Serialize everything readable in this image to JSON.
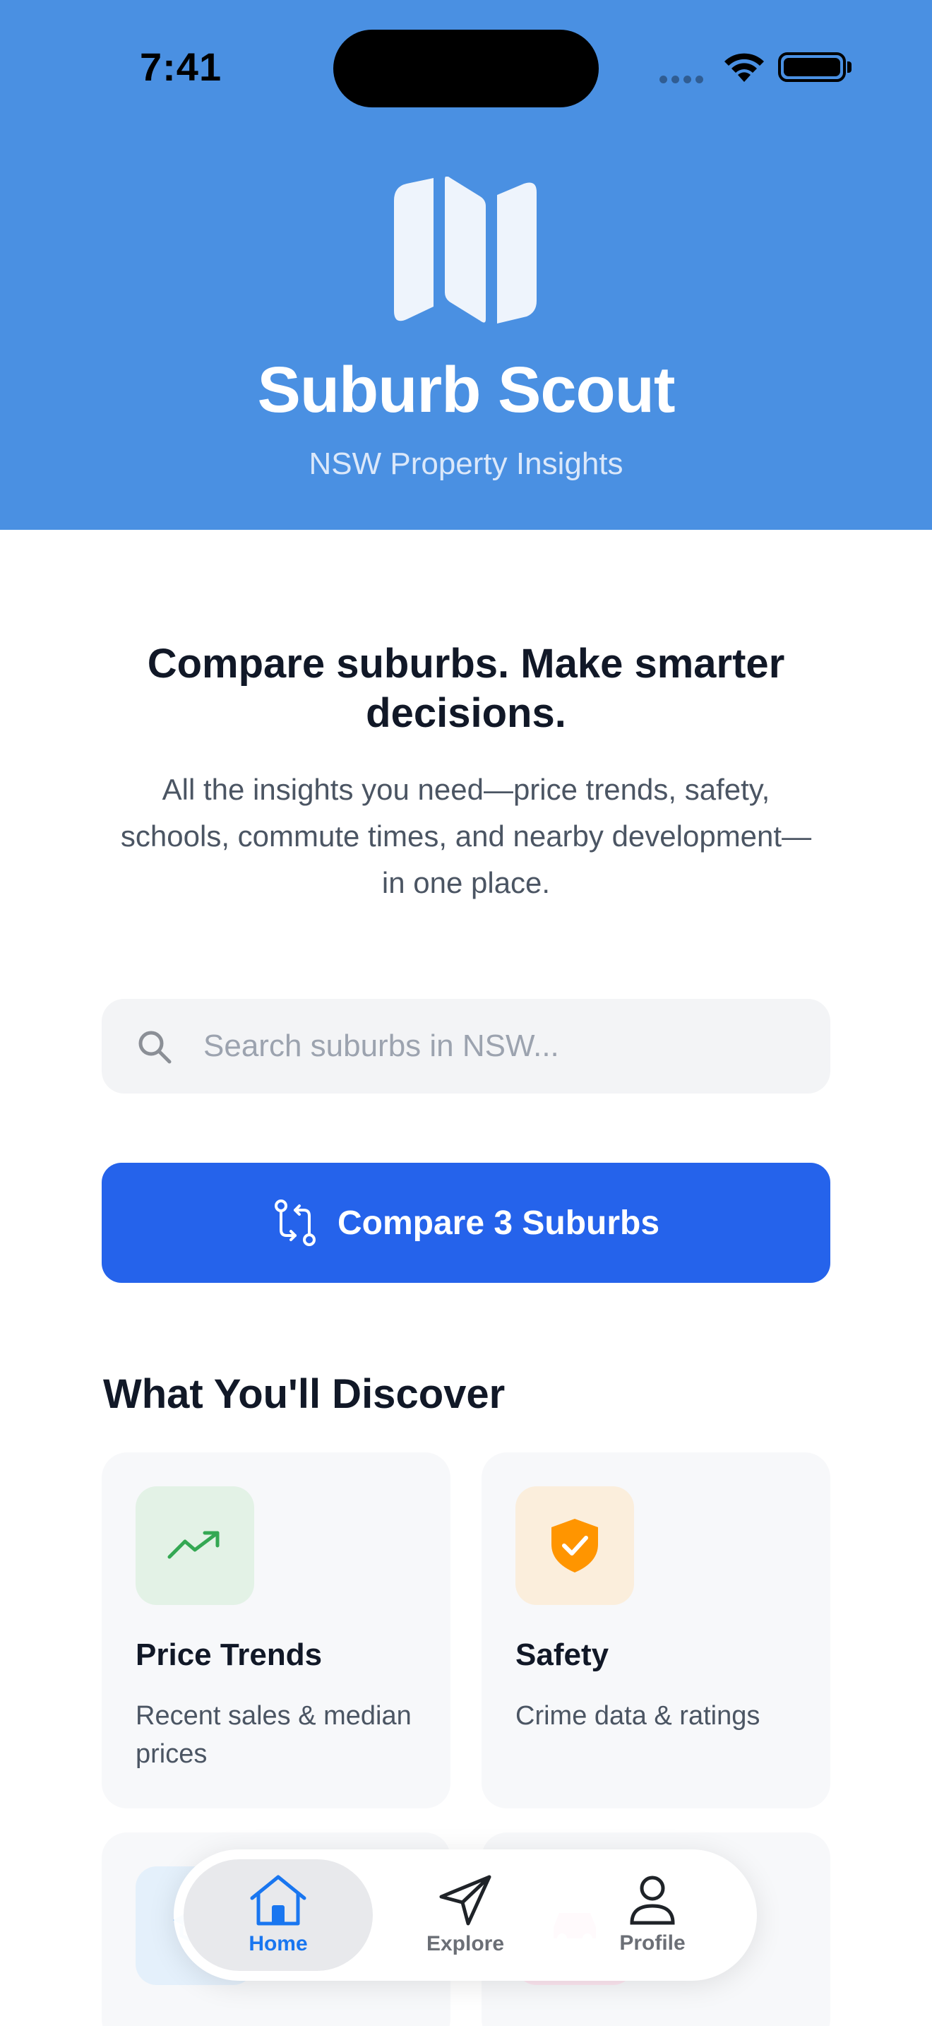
{
  "status_bar": {
    "time": "7:41"
  },
  "header": {
    "app_title": "Suburb Scout",
    "app_subtitle": "NSW Property Insights",
    "logo_icon": "map-icon",
    "background": "#4a90e2"
  },
  "intro": {
    "headline": "Compare suburbs. Make smarter decisions.",
    "description": "All the insights you need—price trends, safety, schools, commute times, and nearby development—in one place."
  },
  "search": {
    "icon": "search-icon",
    "placeholder": "Search suburbs in NSW...",
    "value": ""
  },
  "compare_button": {
    "icon": "compare-arrows-icon",
    "label": "Compare 3 Suburbs",
    "color": "#2563eb"
  },
  "discover": {
    "title": "What You'll Discover",
    "cards": [
      {
        "title": "Price Trends",
        "description": "Recent sales & median prices",
        "icon": "trending-up-icon",
        "icon_color": "#34a853",
        "icon_bg": "#e3f2e6"
      },
      {
        "title": "Safety",
        "description": "Crime data & ratings",
        "icon": "shield-check-icon",
        "icon_color": "#ff9500",
        "icon_bg": "#fbeedc"
      },
      {
        "title": "",
        "description": "",
        "icon": "school-icon",
        "icon_color": "#5ab0ff",
        "icon_bg": "#e4f0fb"
      },
      {
        "title": "",
        "description": "",
        "icon": "car-icon",
        "icon_color": "#ff5fa8",
        "icon_bg": "#fde6f1"
      }
    ]
  },
  "tabbar": {
    "tabs": [
      {
        "label": "Home",
        "icon": "home-icon",
        "active": true
      },
      {
        "label": "Explore",
        "icon": "send-icon",
        "active": false
      },
      {
        "label": "Profile",
        "icon": "person-icon",
        "active": false
      }
    ],
    "active_color": "#1976f0"
  }
}
